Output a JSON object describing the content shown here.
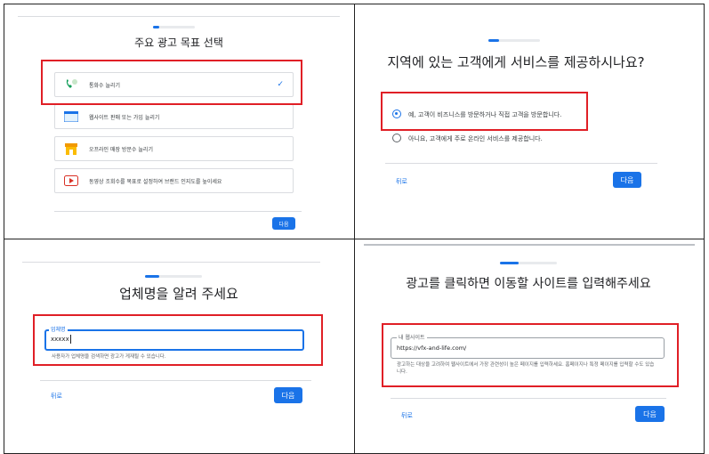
{
  "panel1": {
    "title": "주요 광고 목표 선택",
    "options": [
      {
        "label": "통화수 늘리기",
        "icon": "phone-icon",
        "selected": true
      },
      {
        "label": "웹사이트 판매 또는 가입 늘리기",
        "icon": "website-icon",
        "selected": false
      },
      {
        "label": "오프라인 매장 방문수 늘리기",
        "icon": "store-icon",
        "selected": false
      },
      {
        "label": "동영상 조회수를 목표로 설정하여 브랜드 인지도를 높이세요",
        "icon": "video-icon",
        "selected": false
      }
    ],
    "next": "다음",
    "progress": 0.15
  },
  "panel2": {
    "title": "지역에 있는 고객에게 서비스를 제공하시나요?",
    "options": [
      {
        "label": "예, 고객이 비즈니스를 방문하거나 직접 고객을 방문합니다.",
        "selected": true
      },
      {
        "label": "아니요, 고객에게 주로 온라인 서비스를 제공합니다.",
        "selected": false
      }
    ],
    "back": "뒤로",
    "next": "다음",
    "progress": 0.2
  },
  "panel3": {
    "title": "업체명을 알려 주세요",
    "field_label": "업체명",
    "field_value": "xxxxx",
    "helper": "사용자가 업체명을 검색하면 광고가 게재될 수 있습니다.",
    "back": "뒤로",
    "next": "다음",
    "progress": 0.25
  },
  "panel4": {
    "title": "광고를 클릭하면 이동할 사이트를 입력해주세요",
    "field_label": "내 웹사이트",
    "field_value": "https://vfx-and-life.com/",
    "helper": "광고하는 대상을 고려하여 웹사이트에서 가장 관련성이 높은 페이지를 입력하세요. 홈페이지나 특정 페이지를 입력할 수도 있습니다.",
    "back": "뒤로",
    "next": "다음",
    "progress": 0.3
  },
  "colors": {
    "accent": "#1a73e8",
    "highlight": "#e01f26"
  }
}
